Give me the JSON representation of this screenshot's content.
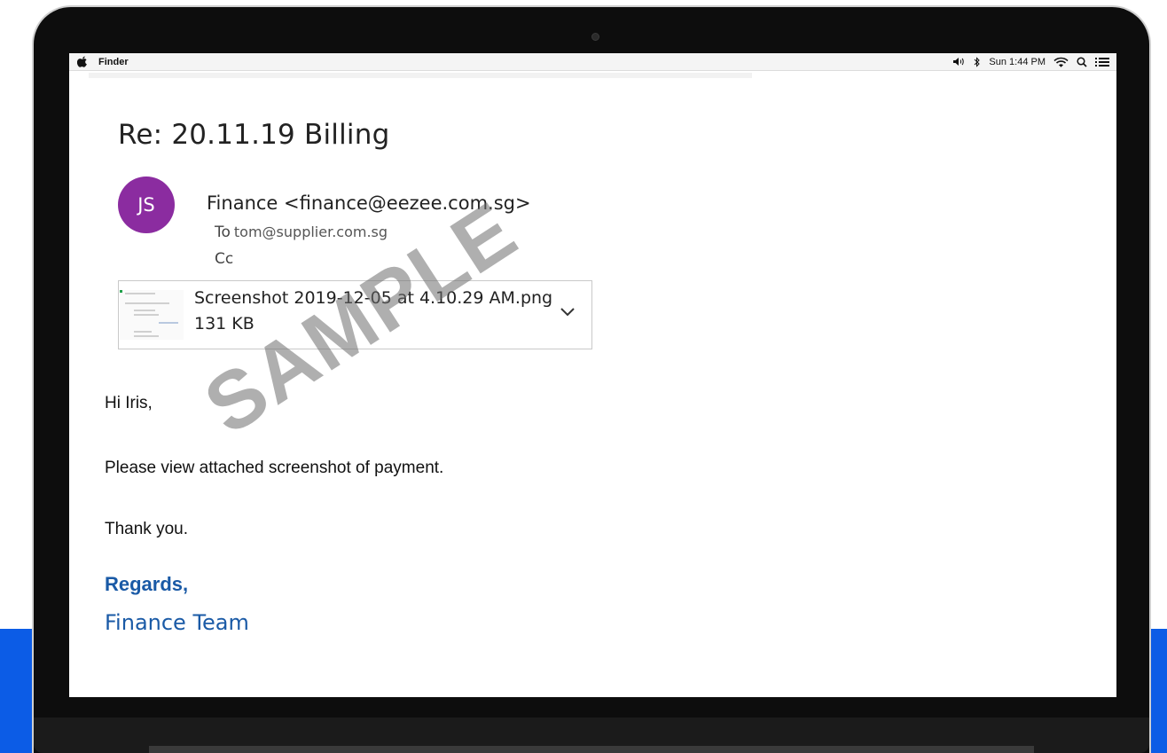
{
  "menubar": {
    "app_name": "Finder",
    "clock": "Sun 1:44 PM",
    "icons": [
      "apple-icon",
      "volume-icon",
      "bluetooth-icon",
      "wifi-icon",
      "spotlight-search-icon",
      "menu-list-icon"
    ]
  },
  "email": {
    "subject": "Re: 20.11.19 Billing",
    "avatar_initials": "JS",
    "avatar_color": "#8b2ca0",
    "sender": "Finance <finance@eezee.com.sg>",
    "to_label": "To",
    "to_address": "tom@supplier.com.sg",
    "cc_label": "Cc",
    "attachment": {
      "name": "Screenshot 2019-12-05 at 4.10.29 AM.png",
      "size": "131 KB"
    },
    "greeting": "Hi Iris,",
    "body": "Please view attached screenshot of payment.",
    "closing": "Thank you.",
    "signoff": "Regards,",
    "signature": "Finance Team",
    "signature_color": "#1a5aa6"
  },
  "watermark": "SAMPLE",
  "accent_color": "#0c5ce6"
}
